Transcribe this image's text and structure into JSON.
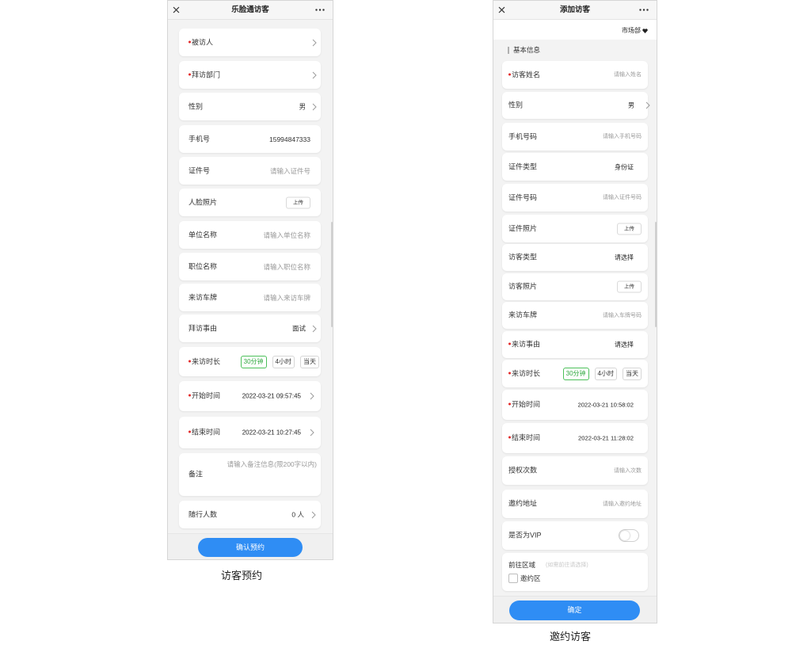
{
  "left": {
    "title": "乐脸通访客",
    "fields": [
      {
        "label": "被访人",
        "required": true
      },
      {
        "label": "拜访部门",
        "required": true
      },
      {
        "label": "性别",
        "value": "男"
      },
      {
        "label": "手机号",
        "value": "15994847333"
      },
      {
        "label": "证件号",
        "placeholder": "请输入证件号"
      },
      {
        "label": "人脸照片",
        "button": "上传"
      },
      {
        "label": "单位名称",
        "placeholder": "请输入单位名称"
      },
      {
        "label": "职位名称",
        "placeholder": "请输入职位名称"
      },
      {
        "label": "来访车牌",
        "placeholder": "请输入来访车牌"
      },
      {
        "label": "拜访事由",
        "value": "面试"
      },
      {
        "label": "来访时长",
        "required": true,
        "options": [
          "30分钟",
          "4小时",
          "当天"
        ],
        "selected_index": 0
      },
      {
        "label": "开始时间",
        "required": true,
        "value": "2022-03-21 09:57:45"
      },
      {
        "label": "结束时间",
        "required": true,
        "value": "2022-03-21 10:27:45"
      },
      {
        "label": "备注",
        "placeholder": "请输入备注信息(限200字以内)"
      },
      {
        "label": "随行人数",
        "value": "0 人"
      }
    ],
    "submit_label": "确认预约",
    "caption": "访客预约"
  },
  "right": {
    "title": "添加访客",
    "department": "市场部",
    "section_title": "基本信息",
    "fields": [
      {
        "label": "访客姓名",
        "required": true,
        "placeholder": "请输入姓名"
      },
      {
        "label": "性别",
        "value": "男"
      },
      {
        "label": "手机号码",
        "placeholder": "请输入手机号码"
      },
      {
        "label": "证件类型",
        "value": "身份证"
      },
      {
        "label": "证件号码",
        "placeholder": "请输入证件号码"
      },
      {
        "label": "证件照片",
        "button": "上传"
      },
      {
        "label": "访客类型",
        "value": "请选择"
      },
      {
        "label": "访客照片",
        "button": "上传"
      },
      {
        "label": "来访车牌",
        "placeholder": "请输入车牌号码"
      },
      {
        "label": "来访事由",
        "required": true,
        "value": "请选择"
      },
      {
        "label": "来访时长",
        "required": true,
        "options": [
          "30分钟",
          "4小时",
          "当天"
        ],
        "selected_index": 0
      },
      {
        "label": "开始时间",
        "required": true,
        "value": "2022-03-21 10:58:02"
      },
      {
        "label": "结束时间",
        "required": true,
        "value": "2022-03-21 11:28:02"
      },
      {
        "label": "授权次数",
        "placeholder": "请输入次数"
      },
      {
        "label": "邀约地址",
        "placeholder": "请输入邀约地址"
      },
      {
        "label": "是否为VIP",
        "toggle_on": false
      },
      {
        "label": "前往区域",
        "hint": "(如需前往请选择)",
        "checkbox_label": "邀约区",
        "checked": false
      }
    ],
    "submit_label": "确定",
    "caption": "邀约访客"
  },
  "icons": {
    "close": "close-icon",
    "more": "more-icon",
    "chevron": "chevron-right-icon",
    "dropdown": "dropdown-caret-icon"
  },
  "colors": {
    "primary_button": "#2f8df4",
    "selected_option": "#2fa83f",
    "required_marker": "#e42a2a",
    "page_background": "#f3f3f3"
  }
}
